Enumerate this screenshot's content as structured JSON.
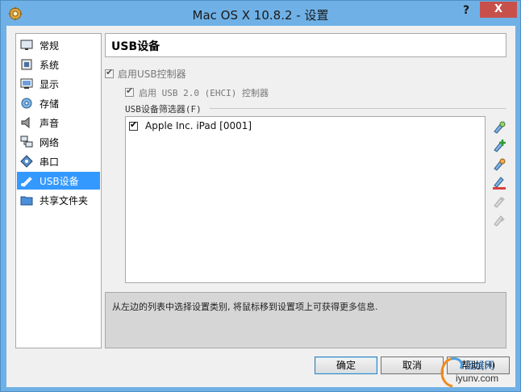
{
  "window": {
    "title": "Mac OS X 10.8.2 - 设置",
    "help_label": "?",
    "close_label": "X"
  },
  "sidebar": {
    "items": [
      {
        "label": "常规",
        "icon": "monitor-general-icon"
      },
      {
        "label": "系统",
        "icon": "chip-system-icon"
      },
      {
        "label": "显示",
        "icon": "display-icon"
      },
      {
        "label": "存储",
        "icon": "disk-storage-icon"
      },
      {
        "label": "声音",
        "icon": "speaker-icon"
      },
      {
        "label": "网络",
        "icon": "network-icon"
      },
      {
        "label": "串口",
        "icon": "serial-port-icon"
      },
      {
        "label": "USB设备",
        "icon": "usb-icon"
      },
      {
        "label": "共享文件夹",
        "icon": "folder-icon"
      }
    ],
    "selected": "USB设备"
  },
  "panel": {
    "title": "USB设备",
    "enable_usb_label": "启用USB控制器",
    "enable_usb2_label": "启用 USB 2.0 (EHCI) 控制器",
    "filters_title": "USB设备筛选器(F)",
    "filters": [
      {
        "label": "Apple Inc. iPad [0001]",
        "checked": true
      }
    ]
  },
  "toolbar": {
    "add_filter": "add-filter-icon",
    "add_from_device": "add-from-device-icon",
    "edit_filter": "edit-filter-icon",
    "remove_filter": "remove-filter-icon",
    "move_up": "move-up-icon",
    "move_down": "move-down-icon"
  },
  "info": {
    "text": "从左边的列表中选择设置类别, 将鼠标移到设置项上可获得更多信息."
  },
  "buttons": {
    "ok": "确定",
    "cancel": "取消",
    "help": "帮助(H)"
  },
  "watermark": {
    "line1": "运维网",
    "line2": "iyunv.com"
  },
  "colors": {
    "titlebar": "#6fb1e6",
    "selection": "#3399ff",
    "close": "#c7504b"
  }
}
